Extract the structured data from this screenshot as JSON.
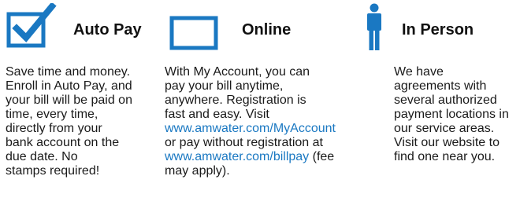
{
  "colors": {
    "accent": "#1a78c2",
    "text": "#1a1a1a",
    "heading": "#111111"
  },
  "autopay": {
    "icon": "checkbox-check-icon",
    "heading": "Auto Pay",
    "lines": [
      "Save time and money.",
      "Enroll in Auto Pay, and",
      "your bill will be paid on",
      "time, every time,",
      "directly from your",
      "bank account on the",
      "due date. No",
      "stamps required!"
    ]
  },
  "online": {
    "icon": "monitor-screen-icon",
    "heading": "Online",
    "line1": "With My Account, you can",
    "line2": "pay your bill anytime,",
    "line3": "anywhere. Registration is",
    "line4": "fast and easy. Visit",
    "link1": "www.amwater.com/MyAccount",
    "line6": "or pay without registration at",
    "link2": "www.amwater.com/billpay",
    "line7_suffix": " (fee",
    "line8": "may apply)."
  },
  "in_person": {
    "icon": "person-icon",
    "heading": "In Person",
    "lines": [
      "We have",
      "agreements with",
      "several authorized",
      "payment locations in",
      "our service areas.",
      "Visit our website to",
      "find one near you."
    ]
  }
}
